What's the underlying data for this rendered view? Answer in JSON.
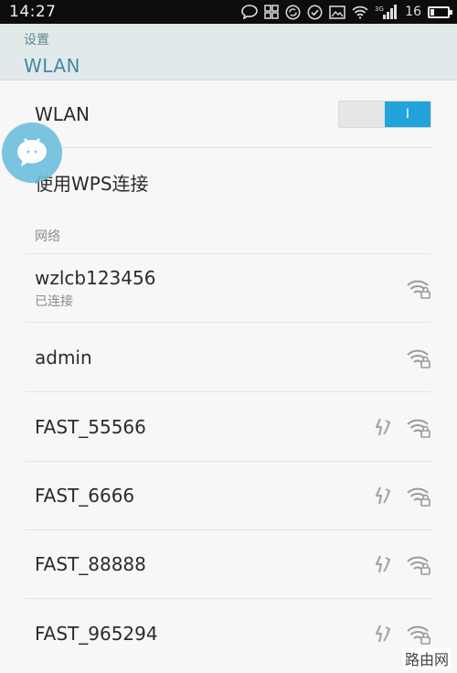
{
  "statusbar": {
    "time": "14:27",
    "signal_label": "3G",
    "battery_level": "16"
  },
  "header": {
    "breadcrumb": "设置",
    "title": "WLAN"
  },
  "wlan_toggle": {
    "label": "WLAN",
    "state_label": "I"
  },
  "wps": {
    "label": "使用WPS连接"
  },
  "section": {
    "title": "网络"
  },
  "networks": [
    {
      "name": "wzlcb123456",
      "status": "已连接",
      "wps": false
    },
    {
      "name": "admin",
      "status": "",
      "wps": false
    },
    {
      "name": "FAST_55566",
      "status": "",
      "wps": true
    },
    {
      "name": "FAST_6666",
      "status": "",
      "wps": true
    },
    {
      "name": "FAST_88888",
      "status": "",
      "wps": true
    },
    {
      "name": "FAST_965294",
      "status": "",
      "wps": true
    }
  ],
  "watermark": {
    "text": "路由网"
  },
  "colors": {
    "accent": "#22a3da",
    "header_bg": "#e2e9ea",
    "title": "#3f8aa2"
  }
}
